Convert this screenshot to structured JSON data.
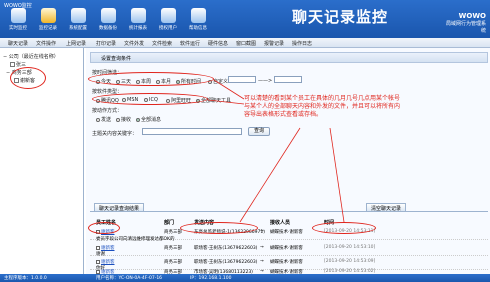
{
  "app": {
    "title": "WOWO监控",
    "hero": "聊天记录监控",
    "brand_name": "WOWO",
    "brand_sub": "局域网行为管理系统"
  },
  "toolbar": [
    {
      "label": "实时监控"
    },
    {
      "label": "监控记录"
    },
    {
      "label": "系统配置"
    },
    {
      "label": "数据备份"
    },
    {
      "label": "统计报表"
    },
    {
      "label": "授权用户"
    },
    {
      "label": "帮助信息"
    }
  ],
  "menu": [
    "聊天记录",
    "文件操作",
    "上网记录",
    "打印记录",
    "文件外发",
    "文件检索",
    "软件运行",
    "硬件信息",
    "窗口截图",
    "报警记录",
    "操作日志"
  ],
  "tree": {
    "root": "公司（最近在线名称）",
    "n1": "张三",
    "n2": "商务三部",
    "n3": "谢新客"
  },
  "panel": {
    "title": "设置查询条件",
    "time_label": "按时间筛选：",
    "time_options": [
      "今天",
      "三天",
      "本周",
      "本月",
      "所有时间",
      "自定义"
    ],
    "to": "——>",
    "type_label": "按软件类型：",
    "type_options": [
      "腾讯QQ",
      "MSN",
      "ICQ",
      "阿里旺旺",
      "全部聊天工具"
    ],
    "dir_label": "按动作方式：",
    "dir_options": [
      "发送",
      "接收",
      "全部消息"
    ],
    "kw_label": "主题关内容关键字：",
    "search_btn": "查询"
  },
  "annotation": "可以清楚的看到某个员工在具体的几月几号几点用某个帐号与某个人的全部聊天内容和外发的文件，并且可以将所有内容导出表格形式查看或存档。",
  "tabs": [
    "聊天记录查询结果",
    "清空聊天记录"
  ],
  "table": {
    "headers": [
      "员工姓名",
      "部门",
      "发送内容",
      "接收人员",
      "时间"
    ],
    "rows": [
      {
        "name": "谢新客",
        "dept": "商务三部",
        "content": "东亮总监老师说-1(13622966971)",
        "arrow": "→",
        "receiver": "蝴蝶技术·谢新客",
        "time": "[2013-09-20 14:53:11]",
        "extra": "委员字段公司向清远维修理发达都OK的"
      },
      {
        "name": "谢新客",
        "dept": "商务三部",
        "content": "职场客·王树东(13679622603)",
        "arrow": "→",
        "receiver": "蝴蝶技术·谢新客",
        "time": "[2013-09-20 14:53:10]",
        "extra": "谢谢"
      },
      {
        "name": "谢新客",
        "dept": "商务三部",
        "content": "职场客·王树东(13679622603)",
        "arrow": "→",
        "receiver": "蝴蝶技术·谢新客",
        "time": "[2013-09-20 14:53:09]",
        "extra": "你好"
      },
      {
        "name": "谢新客",
        "dept": "商务三部",
        "content": "市场客·吴明(13680113223)",
        "arrow": "→",
        "receiver": "蝴蝶技术·谢新客",
        "time": "[2013-09-20 14:53:02]",
        "extra": "已经采购了"
      }
    ]
  },
  "status": {
    "version": "主程序版本：1.0.0.0",
    "user": "用户名称：YC-ON-0A-4F-07-16",
    "ip": "IP：192.168.1.100"
  }
}
